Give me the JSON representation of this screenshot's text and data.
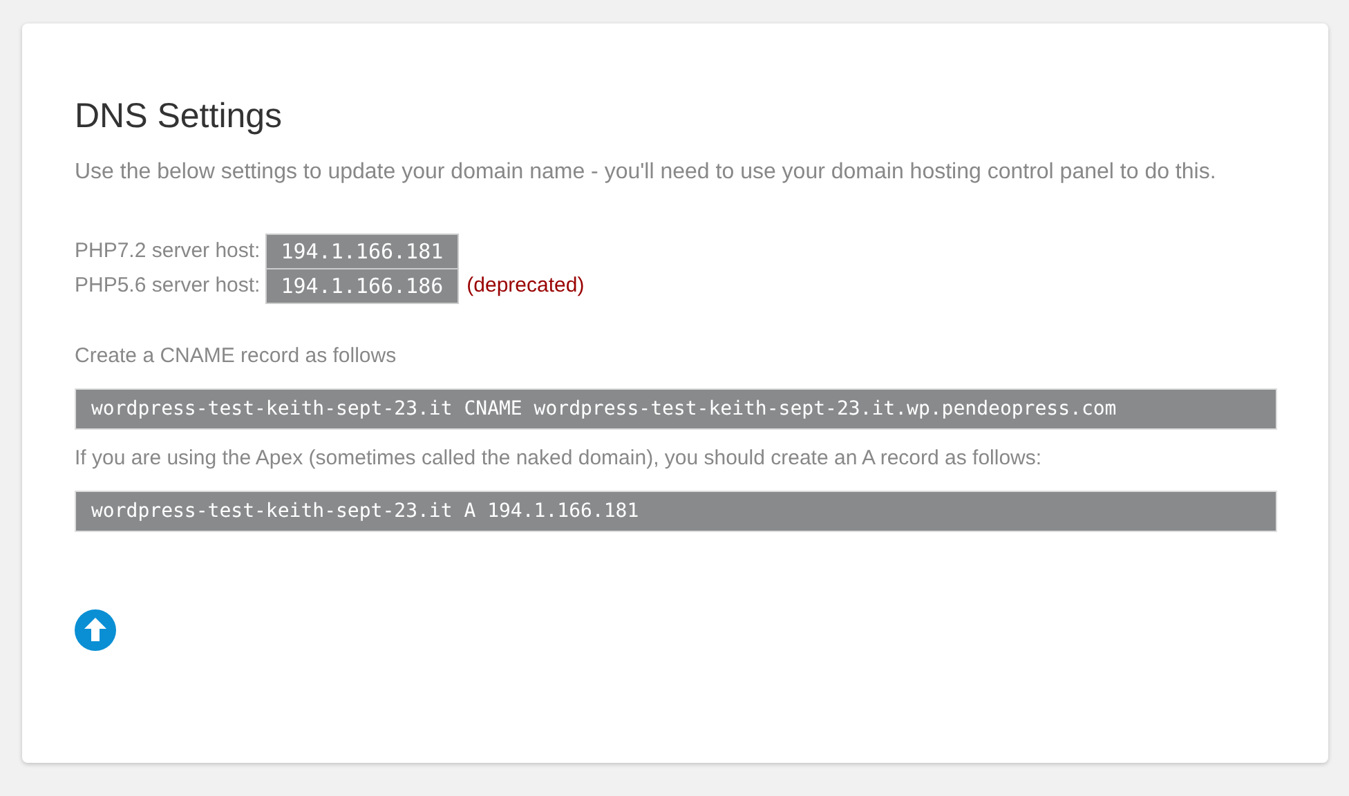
{
  "title": "DNS Settings",
  "intro": "Use the below settings to update your domain name - you'll need to use your domain hosting control panel to do this.",
  "hosts": [
    {
      "label": "PHP7.2 server host:",
      "address": "194.1.166.181"
    },
    {
      "label": "PHP5.6 server host:",
      "address": "194.1.166.186",
      "note": "(deprecated)"
    }
  ],
  "cname": {
    "instruction": "Create a CNAME record as follows",
    "record": "wordpress-test-keith-sept-23.it CNAME wordpress-test-keith-sept-23.it.wp.pendeopress.com"
  },
  "a_record": {
    "instruction": "If you are using the Apex (sometimes called the naked domain), you should create an A record as follows:",
    "record": "wordpress-test-keith-sept-23.it A 194.1.166.181"
  }
}
